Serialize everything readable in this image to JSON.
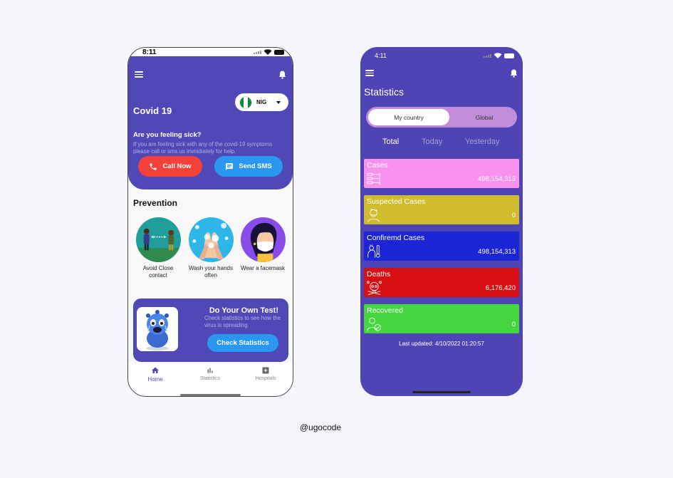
{
  "home": {
    "status_time": "8:11",
    "title": "Covid 19",
    "country": {
      "code": "NIG",
      "flag_colors": [
        "#0a8a3a",
        "#ffffff",
        "#0a8a3a"
      ]
    },
    "sick_title": "Are you feeling sick?",
    "sick_text": "If you are feeling sick with any of the covid-19 symptoms please call or sms us immidiately for help.",
    "call_label": "Call Now",
    "sms_label": "Send SMS",
    "prevention_title": "Prevention",
    "prevention": [
      {
        "label": "Avoid Close contact",
        "icon": "distance-icon"
      },
      {
        "label": "Wash your hands often",
        "icon": "handwash-icon"
      },
      {
        "label": "Wear a facemask",
        "icon": "facemask-icon"
      }
    ],
    "test_card": {
      "title": "Do Your Own Test!",
      "text": "Check statistics to see how the virus is spreading",
      "button": "Check Statistics"
    },
    "nav": [
      {
        "label": "Home",
        "icon": "home-icon",
        "active": true
      },
      {
        "label": "Statistics",
        "icon": "bar-chart-icon",
        "active": false
      },
      {
        "label": "Hospitals",
        "icon": "hospital-icon",
        "active": false
      }
    ]
  },
  "stats": {
    "status_time": "4:11",
    "title": "Statistics",
    "segments": [
      "My country",
      "Global"
    ],
    "tabs": [
      "Total",
      "Today",
      "Yesterday"
    ],
    "cards": [
      {
        "label": "Cases",
        "value": "498,154,313",
        "color": "#f992ef",
        "icon": "cases-icon"
      },
      {
        "label": "Suspected Cases",
        "value": "0",
        "color": "#d0bc2c",
        "icon": "suspected-icon"
      },
      {
        "label": "Confiremd Cases",
        "value": "498,154,313",
        "color": "#1c25d5",
        "icon": "thermometer-icon"
      },
      {
        "label": "Deaths",
        "value": "6,176,420",
        "color": "#d70f13",
        "icon": "skull-icon"
      },
      {
        "label": "Recovered",
        "value": "0",
        "color": "#45d53f",
        "icon": "recovered-icon"
      }
    ],
    "last_updated": "Last updated: 4/10/2022 01:20:57"
  },
  "credit": "@ugocode",
  "colors": {
    "primary": "#5148b8",
    "call": "#f4413a",
    "accent": "#2a97f0",
    "segment": "#c18cd9"
  }
}
